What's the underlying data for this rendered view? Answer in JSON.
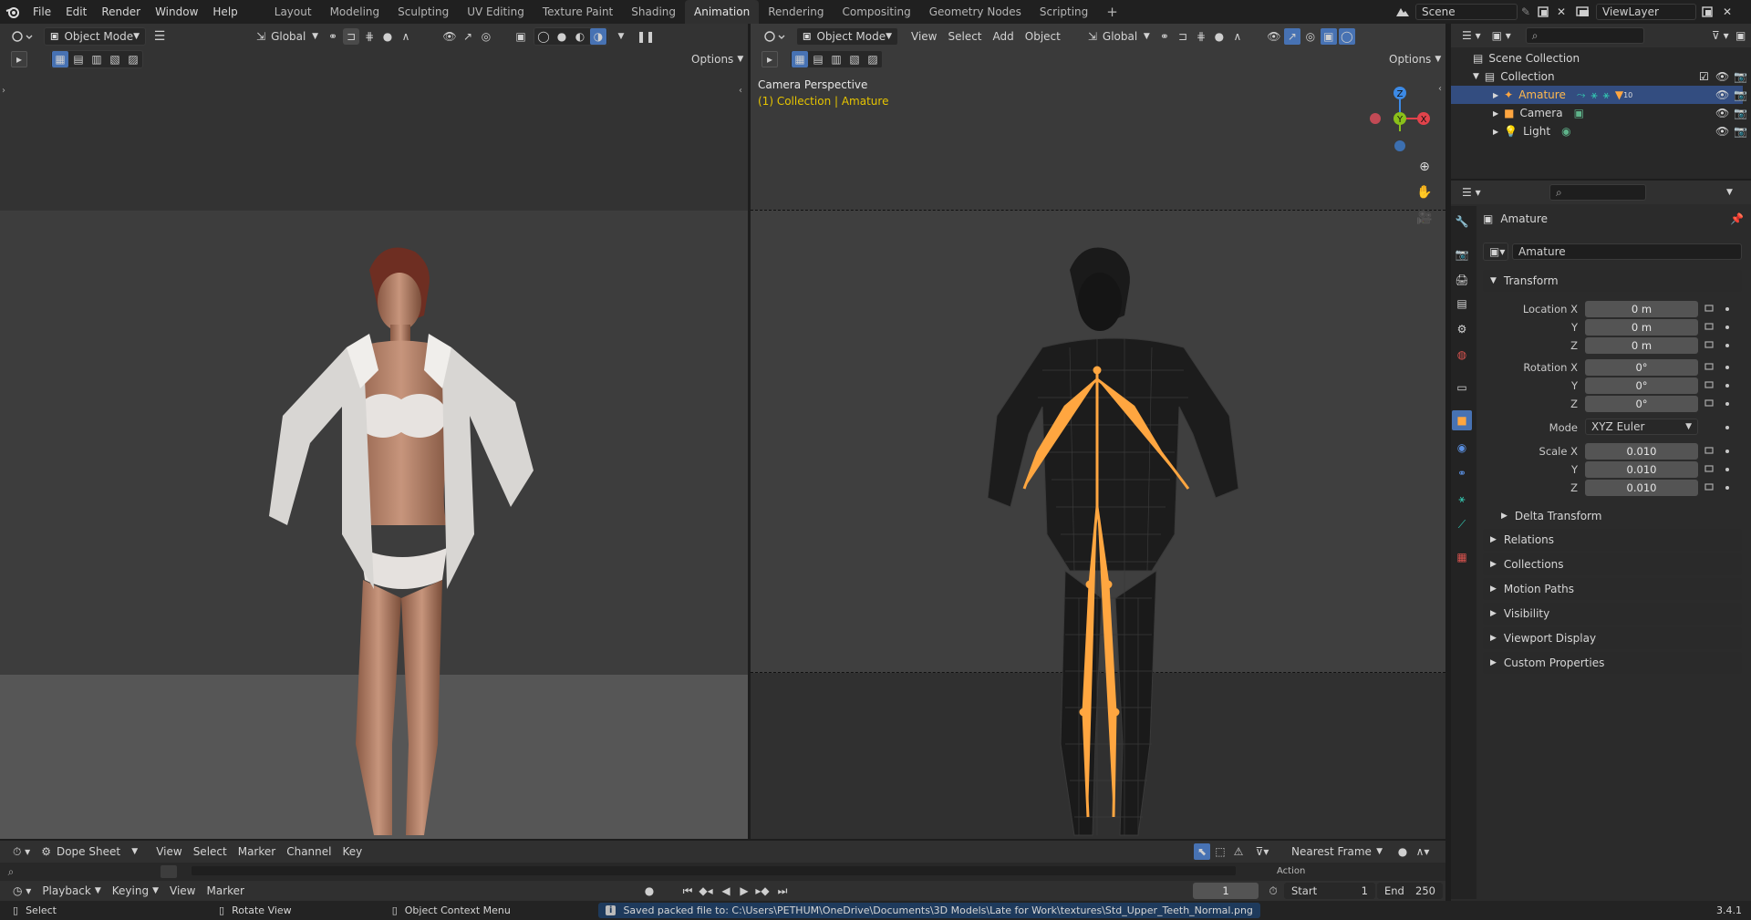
{
  "topbar": {
    "menus": [
      "File",
      "Edit",
      "Render",
      "Window",
      "Help"
    ],
    "workspaces": [
      "Layout",
      "Modeling",
      "Sculpting",
      "UV Editing",
      "Texture Paint",
      "Shading",
      "Animation",
      "Rendering",
      "Compositing",
      "Geometry Nodes",
      "Scripting"
    ],
    "active_workspace": "Animation",
    "add_tab": "+",
    "scene": "Scene",
    "view_layer": "ViewLayer"
  },
  "left_viewport": {
    "mode": "Object Mode",
    "orientation": "Global",
    "options": "Options"
  },
  "right_viewport": {
    "mode": "Object Mode",
    "menus": [
      "View",
      "Select",
      "Add",
      "Object"
    ],
    "orientation": "Global",
    "options": "Options",
    "overlay_title": "Camera Perspective",
    "overlay_subtitle": "(1) Collection | Amature",
    "gizmo": {
      "z": "Z",
      "y": "Y",
      "x": "X"
    }
  },
  "outliner": {
    "search_placeholder": "",
    "scene_collection": "Scene Collection",
    "collection": "Collection",
    "items": [
      {
        "label": "Amature",
        "selected": true,
        "extra": "10"
      },
      {
        "label": "Camera",
        "selected": false
      },
      {
        "label": "Light",
        "selected": false
      }
    ]
  },
  "properties": {
    "object_name": "Amature",
    "data_name": "Amature",
    "transform_label": "Transform",
    "location_label": "Location X",
    "rotation_label": "Rotation X",
    "scale_label": "Scale X",
    "y": "Y",
    "z": "Z",
    "location": [
      "0 m",
      "0 m",
      "0 m"
    ],
    "rotation": [
      "0°",
      "0°",
      "0°"
    ],
    "mode_label": "Mode",
    "mode_value": "XYZ Euler",
    "scale": [
      "0.010",
      "0.010",
      "0.010"
    ],
    "delta": "Delta Transform",
    "panels": [
      "Relations",
      "Collections",
      "Motion Paths",
      "Visibility",
      "Viewport Display",
      "Custom Properties"
    ]
  },
  "dopesheet": {
    "editor": "Dope Sheet",
    "menus": [
      "View",
      "Select",
      "Marker",
      "Channel",
      "Key"
    ],
    "snap": "Nearest Frame",
    "action_label": "Action"
  },
  "timeline": {
    "menus": [
      "Playback",
      "Keying",
      "View",
      "Marker"
    ],
    "current_frame": "1",
    "start_label": "Start",
    "start": "1",
    "end_label": "End",
    "end": "250"
  },
  "statusbar": {
    "select": "Select",
    "rotate": "Rotate View",
    "context": "Object Context Menu",
    "message": "Saved packed file to: C:\\Users\\PETHUM\\OneDrive\\Documents\\3D Models\\Late for Work\\textures\\Std_Upper_Teeth_Normal.png",
    "version": "3.4.1"
  },
  "colors": {
    "accent": "#4772b3",
    "selection_orange": "#ffa640",
    "overlay_yellow": "#e6c400",
    "x_axis": "#e2434b",
    "y_axis": "#8ac01a",
    "z_axis": "#3c8ae6"
  }
}
